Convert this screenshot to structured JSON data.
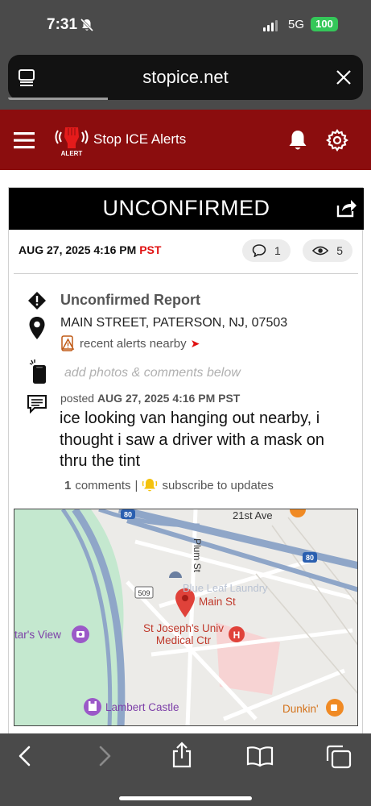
{
  "status_bar": {
    "time": "7:31",
    "network": "5G",
    "battery": "100"
  },
  "browser": {
    "url": "stopice.net"
  },
  "site": {
    "brand": "Stop ICE Alerts",
    "logo_text": "ALERT"
  },
  "report": {
    "status_title": "UNCONFIRMED",
    "date": "AUG 27, 2025 4:16 PM",
    "timezone": "PST",
    "comments_count": "1",
    "views_count": "5",
    "type": "Unconfirmed Report",
    "address": "MAIN STREET, PATERSON, NJ, 07503",
    "nearby_link": "recent alerts nearby",
    "add_photos_hint": "add photos & comments below",
    "posted_prefix": "posted",
    "posted_date": "AUG 27, 2025 4:16 PM",
    "posted_tz": "PST",
    "text": "ice looking van hanging out nearby, i thought i saw a driver with a mask on thru the tint",
    "comments_label_count": "1",
    "comments_label": "comments",
    "separator": "|",
    "subscribe_label": "subscribe to updates"
  },
  "map": {
    "labels": {
      "avenue": "21st Ave",
      "street_vertical": "Plum St",
      "laundry": "Blue Leaf Laundry",
      "pin_label": "Main St",
      "hospital_line1": "St Joseph's Univ",
      "hospital_line2": "Medical Ctr",
      "view": "tar's View",
      "castle": "Lambert Castle",
      "coffee": "Dunkin'",
      "route_80_a": "80",
      "route_80_b": "80",
      "route_509": "509"
    },
    "colors": {
      "park": "#c4e8cf",
      "highway": "#8fa6c8",
      "pin": "#e0423a",
      "hospital": "#f7d3d3",
      "poi_purple": "#9b59c8"
    }
  },
  "colors": {
    "header_bg": "#8b0d0e",
    "chrome_bg": "#4a4a4a",
    "accent_red": "#e01010",
    "battery": "#34c759"
  },
  "icons": [
    "bell-slash-icon",
    "signal-icon",
    "reader-icon",
    "close-icon",
    "hamburger-icon",
    "fist-alert-logo",
    "bell-icon",
    "gear-icon",
    "share-icon",
    "comment-icon",
    "eye-icon",
    "warning-diamond-icon",
    "location-pin-icon",
    "alert-phone-icon",
    "message-icon",
    "warning-triangle-icon",
    "bell-small-icon",
    "back-icon",
    "forward-icon",
    "share-sheet-icon",
    "bookmarks-icon",
    "tabs-icon"
  ]
}
